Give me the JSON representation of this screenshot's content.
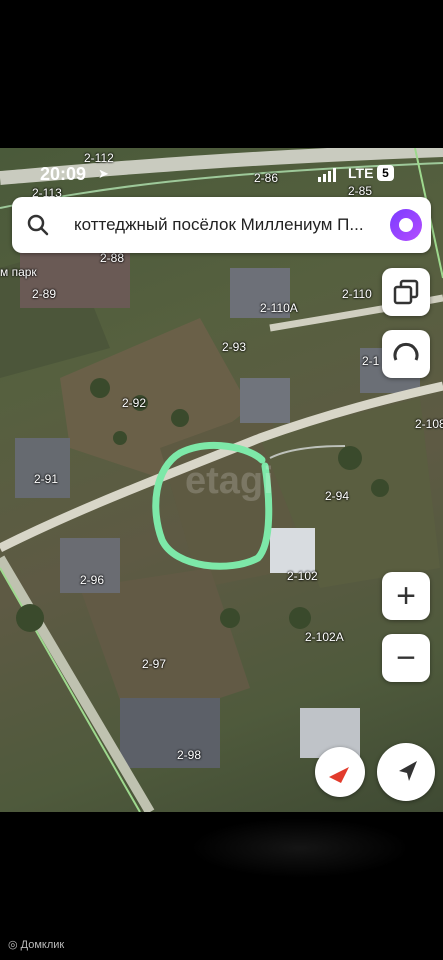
{
  "status": {
    "time": "20:09",
    "network": "LTE",
    "battery": "5"
  },
  "search": {
    "query": "коттеджный посёлок Миллениум П..."
  },
  "labels": {
    "l1": "2-112",
    "l2": "2-113",
    "l3": "2-86",
    "l4": "2-85",
    "l5": "2-88",
    "l6": "м парк",
    "l7": "2-89",
    "l8": "2-110",
    "l9": "2-110А",
    "l10": "2-93",
    "l11": "2-1",
    "l12": "2-92",
    "l13": "2-108",
    "l14": "2-91",
    "l15": "2-94",
    "l16": "2-96",
    "l17": "2-102",
    "l18": "2-97",
    "l19": "2-102А",
    "l20": "2-98"
  },
  "watermark": "etagi",
  "footer": {
    "brand": "Домклик"
  }
}
